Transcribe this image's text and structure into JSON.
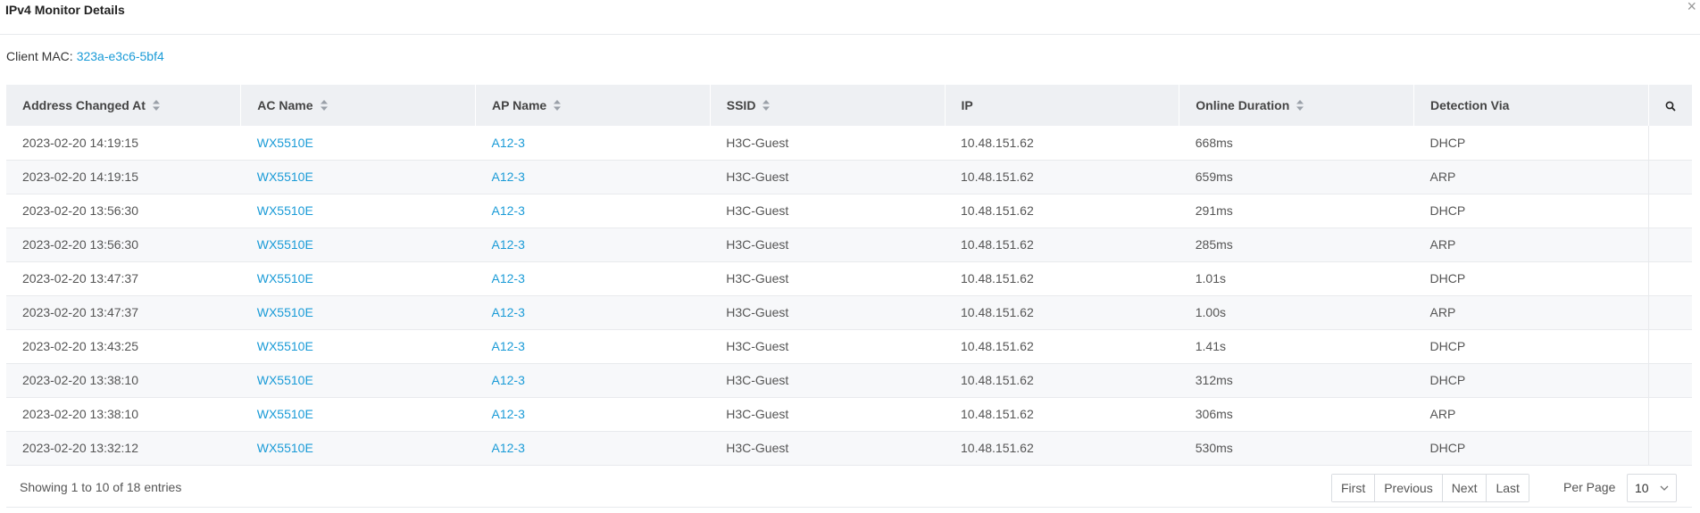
{
  "modal": {
    "title": "IPv4 Monitor Details",
    "close_icon": "close-icon"
  },
  "client": {
    "label": "Client MAC:",
    "mac": "323a-e3c6-5bf4"
  },
  "table": {
    "columns": [
      {
        "label": "Address Changed At",
        "sortable": true
      },
      {
        "label": "AC Name",
        "sortable": true
      },
      {
        "label": "AP Name",
        "sortable": true
      },
      {
        "label": "SSID",
        "sortable": true
      },
      {
        "label": "IP",
        "sortable": false
      },
      {
        "label": "Online Duration",
        "sortable": true
      },
      {
        "label": "Detection Via",
        "sortable": false
      }
    ],
    "search_icon": "search-icon",
    "rows": [
      {
        "time": "2023-02-20 14:19:15",
        "ac": "WX5510E",
        "ap": "A12-3",
        "ssid": "H3C-Guest",
        "ip": "10.48.151.62",
        "duration": "668ms",
        "via": "DHCP"
      },
      {
        "time": "2023-02-20 14:19:15",
        "ac": "WX5510E",
        "ap": "A12-3",
        "ssid": "H3C-Guest",
        "ip": "10.48.151.62",
        "duration": "659ms",
        "via": "ARP"
      },
      {
        "time": "2023-02-20 13:56:30",
        "ac": "WX5510E",
        "ap": "A12-3",
        "ssid": "H3C-Guest",
        "ip": "10.48.151.62",
        "duration": "291ms",
        "via": "DHCP"
      },
      {
        "time": "2023-02-20 13:56:30",
        "ac": "WX5510E",
        "ap": "A12-3",
        "ssid": "H3C-Guest",
        "ip": "10.48.151.62",
        "duration": "285ms",
        "via": "ARP"
      },
      {
        "time": "2023-02-20 13:47:37",
        "ac": "WX5510E",
        "ap": "A12-3",
        "ssid": "H3C-Guest",
        "ip": "10.48.151.62",
        "duration": "1.01s",
        "via": "DHCP"
      },
      {
        "time": "2023-02-20 13:47:37",
        "ac": "WX5510E",
        "ap": "A12-3",
        "ssid": "H3C-Guest",
        "ip": "10.48.151.62",
        "duration": "1.00s",
        "via": "ARP"
      },
      {
        "time": "2023-02-20 13:43:25",
        "ac": "WX5510E",
        "ap": "A12-3",
        "ssid": "H3C-Guest",
        "ip": "10.48.151.62",
        "duration": "1.41s",
        "via": "DHCP"
      },
      {
        "time": "2023-02-20 13:38:10",
        "ac": "WX5510E",
        "ap": "A12-3",
        "ssid": "H3C-Guest",
        "ip": "10.48.151.62",
        "duration": "312ms",
        "via": "DHCP"
      },
      {
        "time": "2023-02-20 13:38:10",
        "ac": "WX5510E",
        "ap": "A12-3",
        "ssid": "H3C-Guest",
        "ip": "10.48.151.62",
        "duration": "306ms",
        "via": "ARP"
      },
      {
        "time": "2023-02-20 13:32:12",
        "ac": "WX5510E",
        "ap": "A12-3",
        "ssid": "H3C-Guest",
        "ip": "10.48.151.62",
        "duration": "530ms",
        "via": "DHCP"
      }
    ]
  },
  "footer": {
    "showing": "Showing 1 to 10 of 18 entries",
    "pager": {
      "first": "First",
      "previous": "Previous",
      "next": "Next",
      "last": "Last"
    },
    "per_page_label": "Per Page",
    "per_page_value": "10"
  },
  "colors": {
    "link": "#1a9bd7",
    "header_bg": "#eef0f3",
    "stripe_bg": "#f7f8fa"
  }
}
